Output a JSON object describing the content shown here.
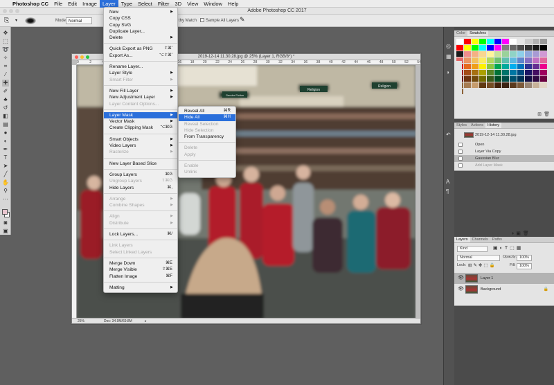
{
  "menubar": {
    "app": "Photoshop CC",
    "items": [
      "File",
      "Edit",
      "Image",
      "Layer",
      "Type",
      "Select",
      "Filter",
      "3D",
      "View",
      "Window",
      "Help"
    ],
    "active": "Layer"
  },
  "window": {
    "title": "Adobe Photoshop CC 2017"
  },
  "options": {
    "mode_label": "Mode:",
    "mode_value": "Normal",
    "match_label": "thy Match",
    "sample_all": "Sample All Layers"
  },
  "document": {
    "title": "2019-12-14 11.30.28.jpg @ 25% (Layer 1, RGB/8*) *",
    "zoom": "25%",
    "doc_info": "Doc: 34.9M/69.8M",
    "ruler_ticks": [
      "0",
      "2",
      "4",
      "6",
      "8",
      "10",
      "12",
      "14",
      "16",
      "18",
      "20",
      "22",
      "24",
      "26",
      "28",
      "30",
      "32",
      "34",
      "36",
      "38",
      "40",
      "42",
      "44",
      "46",
      "48",
      "50",
      "52",
      "54"
    ],
    "photo_signs": {
      "left": "Gender Fiction",
      "center": "Religion",
      "right": "Religion"
    }
  },
  "layer_menu": {
    "items": [
      {
        "label": "New",
        "arrow": true
      },
      {
        "label": "Copy CSS"
      },
      {
        "label": "Copy SVG"
      },
      {
        "label": "Duplicate Layer..."
      },
      {
        "label": "Delete",
        "arrow": true
      },
      {
        "sep": true
      },
      {
        "label": "Quick Export as PNG",
        "shortcut": "⇧⌘'"
      },
      {
        "label": "Export As...",
        "shortcut": "⌥⇧⌘'"
      },
      {
        "sep": true
      },
      {
        "label": "Rename Layer..."
      },
      {
        "label": "Layer Style",
        "arrow": true
      },
      {
        "label": "Smart Filter",
        "arrow": true,
        "disabled": true
      },
      {
        "sep": true
      },
      {
        "label": "New Fill Layer",
        "arrow": true
      },
      {
        "label": "New Adjustment Layer",
        "arrow": true
      },
      {
        "label": "Layer Content Options...",
        "disabled": true
      },
      {
        "sep": true
      },
      {
        "label": "Layer Mask",
        "arrow": true,
        "highlighted": true
      },
      {
        "label": "Vector Mask",
        "arrow": true
      },
      {
        "label": "Create Clipping Mask",
        "shortcut": "⌥⌘G"
      },
      {
        "sep": true
      },
      {
        "label": "Smart Objects",
        "arrow": true
      },
      {
        "label": "Video Layers",
        "arrow": true
      },
      {
        "label": "Rasterize",
        "arrow": true,
        "disabled": true
      },
      {
        "sep": true
      },
      {
        "label": "New Layer Based Slice"
      },
      {
        "sep": true
      },
      {
        "label": "Group Layers",
        "shortcut": "⌘G"
      },
      {
        "label": "Ungroup Layers",
        "shortcut": "⇧⌘G",
        "disabled": true
      },
      {
        "label": "Hide Layers",
        "shortcut": "⌘,"
      },
      {
        "sep": true
      },
      {
        "label": "Arrange",
        "arrow": true,
        "disabled": true
      },
      {
        "label": "Combine Shapes",
        "arrow": true,
        "disabled": true
      },
      {
        "sep": true
      },
      {
        "label": "Align",
        "arrow": true,
        "disabled": true
      },
      {
        "label": "Distribute",
        "arrow": true,
        "disabled": true
      },
      {
        "sep": true
      },
      {
        "label": "Lock Layers...",
        "shortcut": "⌘/"
      },
      {
        "sep": true
      },
      {
        "label": "Link Layers",
        "disabled": true
      },
      {
        "label": "Select Linked Layers",
        "disabled": true
      },
      {
        "sep": true
      },
      {
        "label": "Merge Down",
        "shortcut": "⌘E"
      },
      {
        "label": "Merge Visible",
        "shortcut": "⇧⌘E"
      },
      {
        "label": "Flatten Image",
        "shortcut": "⌘F"
      },
      {
        "sep": true
      },
      {
        "label": "Matting",
        "arrow": true
      }
    ]
  },
  "submenu": {
    "items": [
      {
        "label": "Reveal All",
        "shortcut": "⌘R"
      },
      {
        "label": "Hide All",
        "shortcut": "⌘H",
        "highlighted": true
      },
      {
        "label": "Reveal Selection",
        "disabled": true
      },
      {
        "label": "Hide Selection",
        "disabled": true
      },
      {
        "label": "From Transparency"
      },
      {
        "sep": true
      },
      {
        "label": "Delete",
        "disabled": true
      },
      {
        "label": "Apply",
        "disabled": true
      },
      {
        "sep": true
      },
      {
        "label": "Enable",
        "disabled": true
      },
      {
        "label": "Unlink",
        "disabled": true
      }
    ]
  },
  "color_panel": {
    "tabs": [
      "Color",
      "Swatches"
    ],
    "active": "Swatches"
  },
  "history_panel": {
    "tabs": [
      "Styles",
      "Actions",
      "History"
    ],
    "active": "History",
    "snapshot": "2019-12-14 11.30.28.jpg",
    "steps": [
      {
        "label": "Open"
      },
      {
        "label": "Layer Via Copy"
      },
      {
        "label": "Gaussian Blur",
        "highlighted": true
      },
      {
        "label": "Add Layer Mask",
        "dim": true
      }
    ]
  },
  "layers_panel": {
    "tabs": [
      "Layers",
      "Channels",
      "Paths"
    ],
    "active": "Layers",
    "kind": "Kind",
    "blend": "Normal",
    "opacity_label": "Opacity:",
    "opacity": "100%",
    "lock_label": "Lock:",
    "fill_label": "Fill:",
    "fill": "100%",
    "layers": [
      {
        "name": "Layer 1",
        "selected": true
      },
      {
        "name": "Background",
        "locked": true
      }
    ]
  },
  "colors": {
    "accent": "#2a6fdb",
    "menu_bg": "#efefef",
    "dock_bg": "#4b4b4b"
  }
}
